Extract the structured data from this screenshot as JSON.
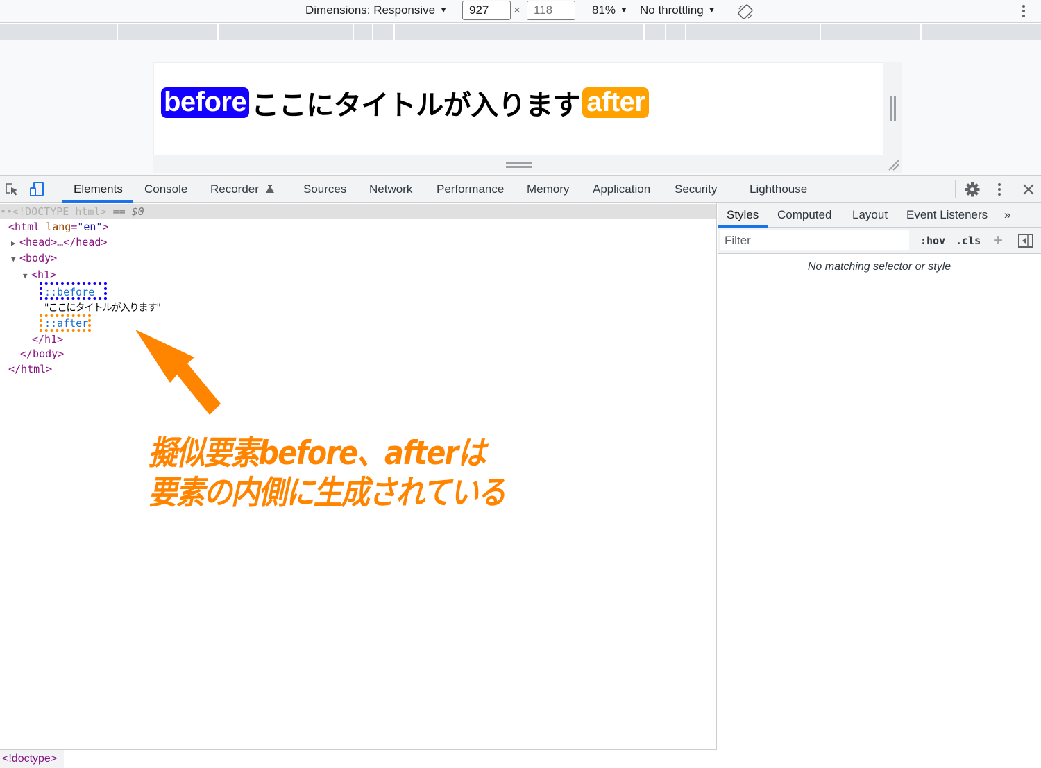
{
  "device_toolbar": {
    "dimensions_label": "Dimensions: Responsive",
    "width_value": "927",
    "height_value": "118",
    "times": "×",
    "zoom": "81%",
    "throttling": "No throttling",
    "caret": "▼"
  },
  "preview": {
    "before_text": "before",
    "title_text": "ここにタイトルが入ります",
    "after_text": "after",
    "colors": {
      "before_bg": "#1400ff",
      "after_bg": "#ffa200"
    }
  },
  "devtools": {
    "tabs": [
      {
        "label": "Elements",
        "active": true
      },
      {
        "label": "Console"
      },
      {
        "label": "Recorder"
      },
      {
        "label": "Sources"
      },
      {
        "label": "Network"
      },
      {
        "label": "Performance"
      },
      {
        "label": "Memory"
      },
      {
        "label": "Application"
      },
      {
        "label": "Security"
      },
      {
        "label": "Lighthouse"
      }
    ],
    "accent": "#1a73e8"
  },
  "dom_tree": {
    "doctype": "<!DOCTYPE html>",
    "selected_marker": "== $0",
    "ellipsis": "••",
    "html_open": "<html",
    "lang_attr": "lang",
    "lang_val": "\"en\"",
    "gt": ">",
    "head": "<head>…</head>",
    "body_open": "<body>",
    "h1_open": "<h1>",
    "before": "::before",
    "text_node": "\"ここにタイトルが入ります\"",
    "after": "::after",
    "h1_close": "</h1>",
    "body_close": "</body>",
    "html_close": "</html>"
  },
  "annotation": {
    "line1": "擬似要素before、afterは",
    "line2": "要素の内側に生成されている",
    "color": "#ff8400"
  },
  "breadcrumb": {
    "items": [
      "<!doctype>"
    ]
  },
  "styles_panel": {
    "tabs": [
      "Styles",
      "Computed",
      "Layout",
      "Event Listeners",
      "»"
    ],
    "filter_placeholder": "Filter",
    "hov": ":hov",
    "cls": ".cls",
    "plus": "+",
    "empty_message": "No matching selector or style"
  }
}
